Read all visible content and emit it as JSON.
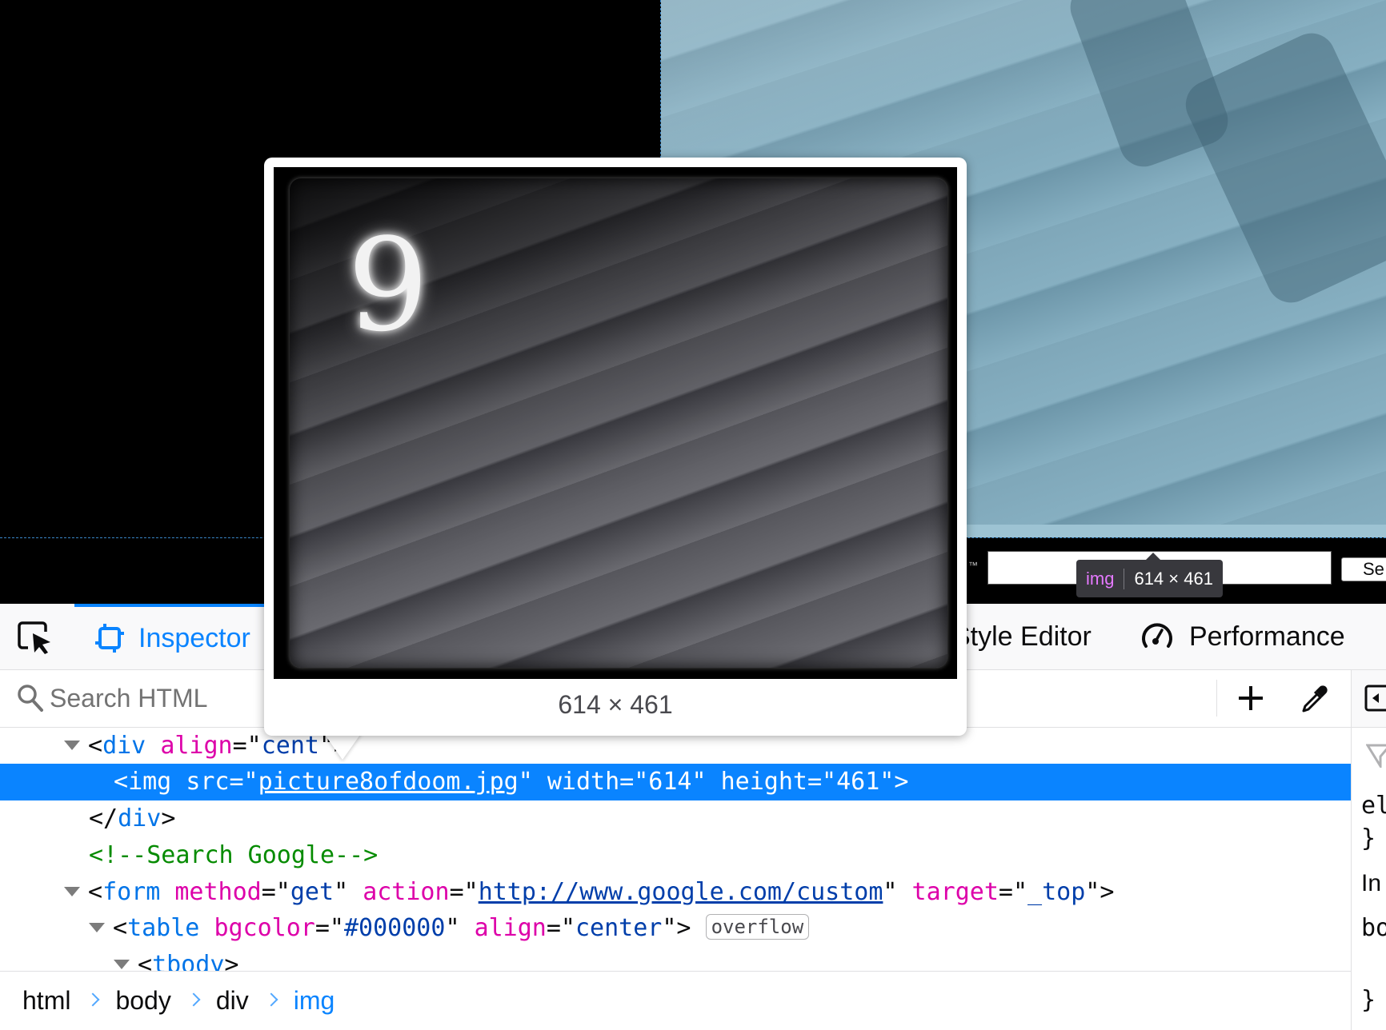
{
  "page": {
    "search_button_label": "Se",
    "trademark": "™"
  },
  "infobar": {
    "tag": "img",
    "dimensions": "614 × 461"
  },
  "toolbar": {
    "tabs": [
      {
        "label": "Inspector",
        "icon": "inspector-icon",
        "active": true
      },
      {
        "label": "Style Editor",
        "visible_label": "Style Editor",
        "icon": "style-editor-icon"
      },
      {
        "label": "Performance",
        "icon": "performance-icon"
      }
    ],
    "picker_icon": "element-picker-icon"
  },
  "search": {
    "placeholder": "Search HTML",
    "value": "",
    "add_node_icon": "plus-icon",
    "eyedropper_icon": "eyedropper-icon"
  },
  "markup": {
    "line1": {
      "tag": "div",
      "attr": "align",
      "value_visible": "cent"
    },
    "line2": {
      "tag": "img",
      "attr_src": "src",
      "src": "picture8ofdoom.jpg",
      "attr_width": "width",
      "width": "614",
      "attr_height": "height",
      "height": "461"
    },
    "line3": {
      "close_tag": "div"
    },
    "line4": {
      "comment": "<!--Search Google-->"
    },
    "line5": {
      "tag": "form",
      "attr_method": "method",
      "method": "get",
      "attr_action": "action",
      "action": "http://www.google.com/custom",
      "attr_target": "target",
      "target": "_top"
    },
    "line6": {
      "tag": "table",
      "attr_bgcolor": "bgcolor",
      "bgcolor": "#000000",
      "attr_align": "align",
      "align": "center",
      "badge": "overflow"
    },
    "line7": {
      "tag": "tbody"
    }
  },
  "breadcrumbs": [
    "html",
    "body",
    "div",
    "img"
  ],
  "preview": {
    "digit": "9",
    "dimensions": "614 × 461"
  },
  "sidebar": {
    "items": [
      "el",
      "}",
      "In",
      "bo",
      "}"
    ]
  }
}
